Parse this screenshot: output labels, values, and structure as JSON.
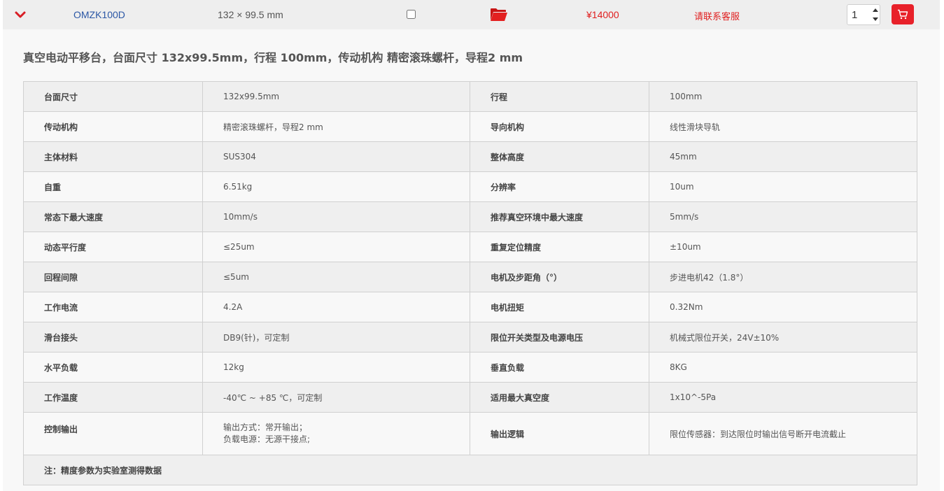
{
  "product": {
    "model": "OMZK100D",
    "dimensions": "132 × 99.5 mm",
    "price": "¥14000",
    "contact": "请联系客服",
    "quantity": "1",
    "colors": {
      "accent": "#e8212a",
      "link": "#2b57a5"
    },
    "icons": [
      "chevron-down-icon",
      "folder-icon",
      "spin-up-icon",
      "spin-down-icon",
      "cart-icon"
    ]
  },
  "detail": {
    "description": "真空电动平移台，台面尺寸 132x99.5mm，行程 100mm，传动机构 精密滚珠螺杆，导程2 mm",
    "specs": [
      {
        "k1": "台面尺寸",
        "v1": "132x99.5mm",
        "k2": "行程",
        "v2": "100mm"
      },
      {
        "k1": "传动机构",
        "v1": "精密滚珠螺杆，导程2 mm",
        "k2": "导向机构",
        "v2": "线性滑块导轨"
      },
      {
        "k1": "主体材料",
        "v1": "SUS304",
        "k2": "整体高度",
        "v2": "45mm"
      },
      {
        "k1": "自重",
        "v1": "6.51kg",
        "k2": "分辨率",
        "v2": "10um"
      },
      {
        "k1": "常态下最大速度",
        "v1": "10mm/s",
        "k2": "推荐真空环境中最大速度",
        "v2": "5mm/s"
      },
      {
        "k1": "动态平行度",
        "v1": "≤25um",
        "k2": "重复定位精度",
        "v2": "±10um"
      },
      {
        "k1": "回程间隙",
        "v1": "≤5um",
        "k2": "电机及步距角（°）",
        "v2": "步进电机42（1.8°）"
      },
      {
        "k1": "工作电流",
        "v1": "4.2A",
        "k2": "电机扭矩",
        "v2": "0.32Nm"
      },
      {
        "k1": "滑台接头",
        "v1": "DB9(针)，可定制",
        "k2": "限位开关类型及电源电压",
        "v2": "机械式限位开关，24V±10%"
      },
      {
        "k1": "水平负载",
        "v1": "12kg",
        "k2": "垂直负载",
        "v2": "8KG"
      },
      {
        "k1": "工作温度",
        "v1": "-40℃ ~ +85 ℃，可定制",
        "k2": "适用最大真空度",
        "v2": "1x10^-5Pa"
      }
    ],
    "control": {
      "k1": "控制输出",
      "v1_line1": "输出方式：常开输出；",
      "v1_line2": "负载电源：无源干接点;",
      "k2": "输出逻辑",
      "v2": "限位传感器：到达限位时输出信号断开电流截止"
    },
    "note": "注：精度参数为实验室测得数据"
  }
}
